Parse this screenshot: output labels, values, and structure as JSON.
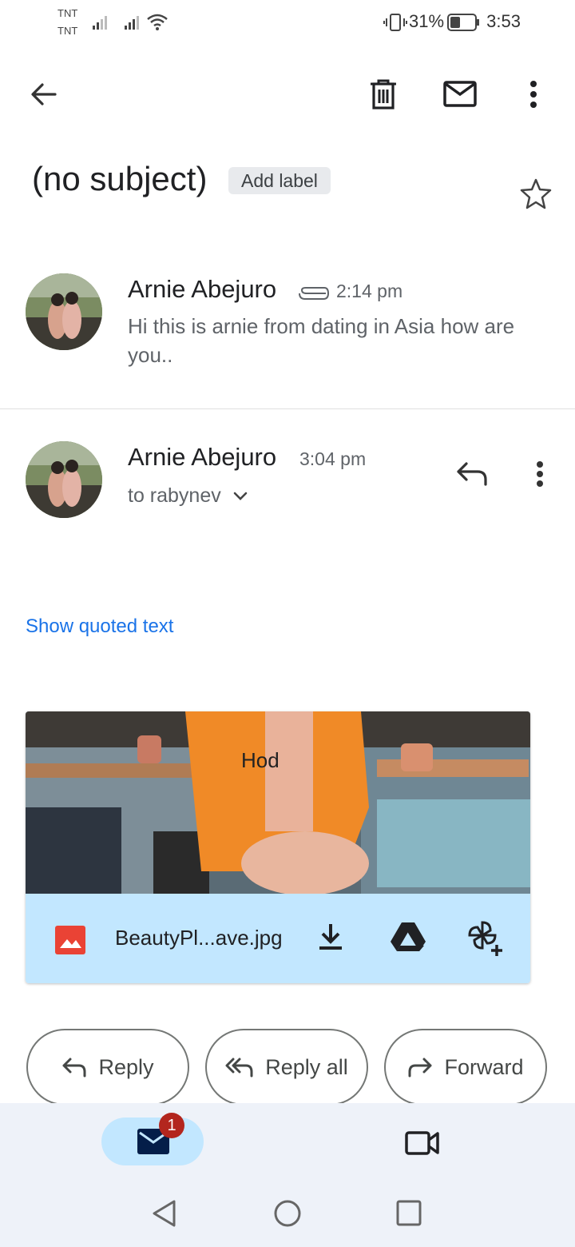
{
  "status_bar": {
    "carrier_1": "TNT",
    "carrier_2": "TNT",
    "battery_percent": "31%",
    "time": "3:53"
  },
  "toolbar": {
    "back_icon": "arrow-left-icon",
    "delete_icon": "trash-icon",
    "mark_unread_icon": "mail-icon",
    "more_icon": "more-vertical-icon"
  },
  "email": {
    "subject": "(no subject)",
    "add_label": "Add label"
  },
  "messages": [
    {
      "sender": "Arnie Abejuro",
      "time": "2:14 pm",
      "snippet": "Hi this is arnie from dating in Asia how are you.."
    },
    {
      "sender": "Arnie Abejuro",
      "time": "3:04 pm",
      "to": "to rabynev",
      "show_quoted": "Show quoted text"
    }
  ],
  "attachment": {
    "filename": "BeautyPl...ave.jpg"
  },
  "actions": {
    "reply": "Reply",
    "reply_all": "Reply all",
    "forward": "Forward"
  },
  "bottom_nav": {
    "mail_badge": "1"
  },
  "colors": {
    "accent": "#1a73e8",
    "chip": "#c2e7ff",
    "badge": "#b3261e"
  }
}
